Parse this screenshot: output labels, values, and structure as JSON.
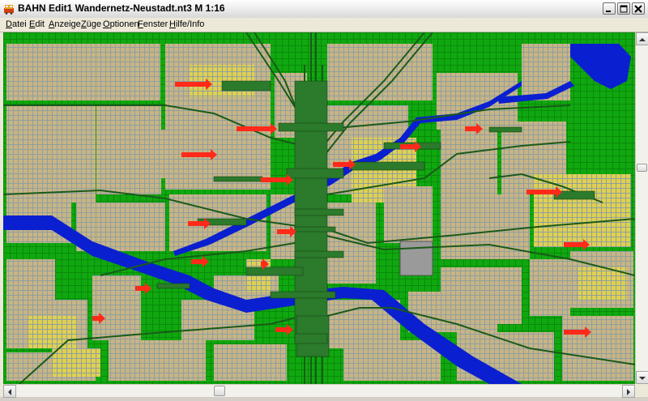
{
  "window": {
    "title": "BAHN Edit1 Wandernetz-Neustadt.nt3 M 1:16"
  },
  "menu": [
    {
      "label": "Datei",
      "accel": "D"
    },
    {
      "label": "Edit",
      "accel": "E"
    },
    {
      "label": "Anzeige",
      "accel": "A"
    },
    {
      "label": "Züge",
      "accel": "Z"
    },
    {
      "label": "Optionen",
      "accel": "O"
    },
    {
      "label": "Fenster",
      "accel": "F"
    },
    {
      "label": "Hilfe/Info",
      "accel": "H"
    }
  ],
  "colors": {
    "grass": "#009a00",
    "block": "#c8b484",
    "road": "#8fa0a0",
    "water": "#0a1fd0",
    "track": "#1a5a1a",
    "platform": "#2c7a2c",
    "arrow": "#ff2a1a",
    "yellow": "#e0e020"
  },
  "icons": {
    "app": "bahn-app-icon",
    "minimize": "minimize-icon",
    "maximize": "maximize-icon",
    "close": "close-icon"
  }
}
